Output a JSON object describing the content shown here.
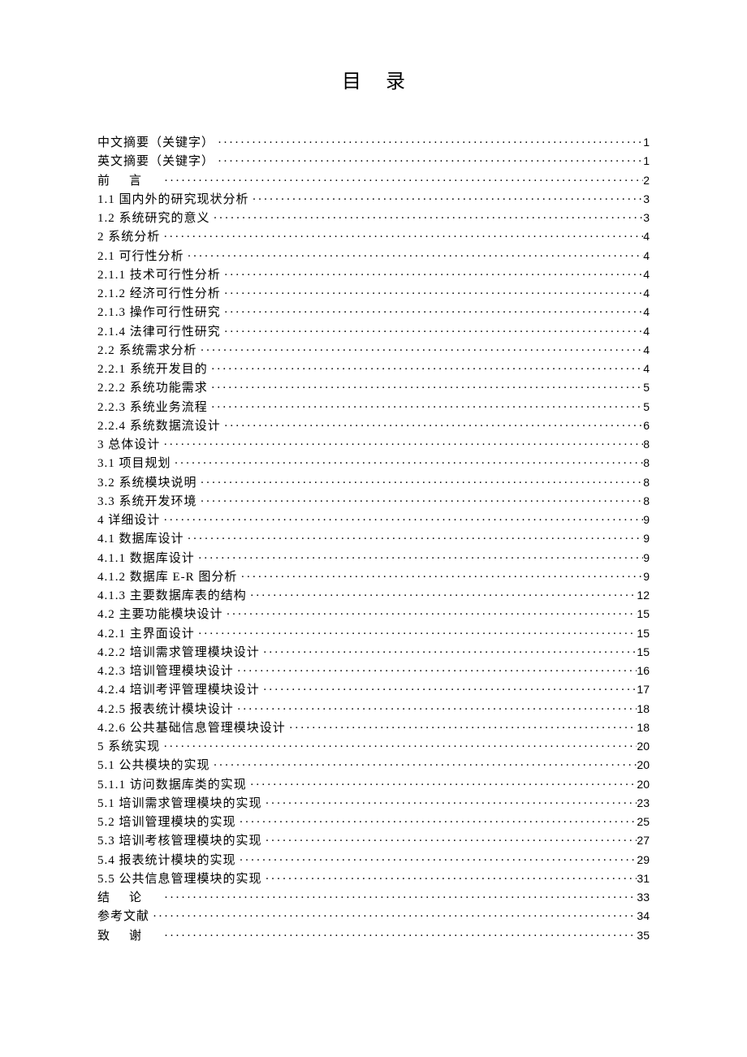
{
  "title": "目录",
  "entries": [
    {
      "label": "中文摘要（关键字）",
      "page": "1",
      "spacing": ""
    },
    {
      "label": "英文摘要（关键字）",
      "page": "1",
      "spacing": ""
    },
    {
      "label": "前言",
      "page": "2",
      "spacing": "spaced-3"
    },
    {
      "label": "1.1 国内外的研究现状分析",
      "page": "3",
      "spacing": ""
    },
    {
      "label": "1.2 系统研究的意义",
      "page": "3",
      "spacing": ""
    },
    {
      "label": "2 系统分析",
      "page": "4",
      "spacing": ""
    },
    {
      "label": "2.1 可行性分析",
      "page": "4",
      "spacing": ""
    },
    {
      "label": "2.1.1 技术可行性分析",
      "page": "4",
      "spacing": ""
    },
    {
      "label": "2.1.2 经济可行性分析",
      "page": "4",
      "spacing": ""
    },
    {
      "label": "2.1.3 操作可行性研究",
      "page": "4",
      "spacing": ""
    },
    {
      "label": "2.1.4 法律可行性研究",
      "page": "4",
      "spacing": ""
    },
    {
      "label": "2.2 系统需求分析",
      "page": "4",
      "spacing": ""
    },
    {
      "label": "2.2.1 系统开发目的",
      "page": "4",
      "spacing": ""
    },
    {
      "label": "2.2.2 系统功能需求",
      "page": "5",
      "spacing": ""
    },
    {
      "label": "2.2.3 系统业务流程",
      "page": "5",
      "spacing": ""
    },
    {
      "label": "2.2.4 系统数据流设计",
      "page": "6",
      "spacing": ""
    },
    {
      "label": "3 总体设计",
      "page": "8",
      "spacing": ""
    },
    {
      "label": "3.1 项目规划",
      "page": "8",
      "spacing": ""
    },
    {
      "label": "3.2 系统模块说明",
      "page": "8",
      "spacing": ""
    },
    {
      "label": "3.3 系统开发环境",
      "page": "8",
      "spacing": ""
    },
    {
      "label": "4 详细设计",
      "page": "9",
      "spacing": ""
    },
    {
      "label": "4.1 数据库设计",
      "page": "9",
      "spacing": ""
    },
    {
      "label": "4.1.1 数据库设计",
      "page": "9",
      "spacing": ""
    },
    {
      "label": "4.1.2 数据库 E-R 图分析",
      "page": "9",
      "spacing": ""
    },
    {
      "label": "4.1.3 主要数据库表的结构",
      "page": "12",
      "spacing": ""
    },
    {
      "label": "4.2 主要功能模块设计",
      "page": "15",
      "spacing": ""
    },
    {
      "label": "4.2.1 主界面设计",
      "page": "15",
      "spacing": ""
    },
    {
      "label": "4.2.2 培训需求管理模块设计",
      "page": "15",
      "spacing": ""
    },
    {
      "label": "4.2.3 培训管理模块设计",
      "page": "16",
      "spacing": ""
    },
    {
      "label": "4.2.4 培训考评管理模块设计",
      "page": "17",
      "spacing": ""
    },
    {
      "label": "4.2.5 报表统计模块设计",
      "page": "18",
      "spacing": ""
    },
    {
      "label": "4.2.6 公共基础信息管理模块设计",
      "page": "18",
      "spacing": ""
    },
    {
      "label": "5 系统实现",
      "page": "20",
      "spacing": ""
    },
    {
      "label": "5.1 公共模块的实现",
      "page": "20",
      "spacing": ""
    },
    {
      "label": "5.1.1 访问数据库类的实现",
      "page": "20",
      "spacing": ""
    },
    {
      "label": "5.1 培训需求管理模块的实现",
      "page": "23",
      "spacing": ""
    },
    {
      "label": "5.2 培训管理模块的实现",
      "page": "25",
      "spacing": ""
    },
    {
      "label": "5.3 培训考核管理模块的实现",
      "page": "27",
      "spacing": ""
    },
    {
      "label": "5.4 报表统计模块的实现",
      "page": "29",
      "spacing": ""
    },
    {
      "label": "5.5 公共信息管理模块的实现",
      "page": "31",
      "spacing": ""
    },
    {
      "label": "结论",
      "page": "33",
      "spacing": "spaced-3"
    },
    {
      "label": "参考文献",
      "page": "34",
      "spacing": ""
    },
    {
      "label": "致谢",
      "page": "35",
      "spacing": "spaced-3"
    }
  ]
}
